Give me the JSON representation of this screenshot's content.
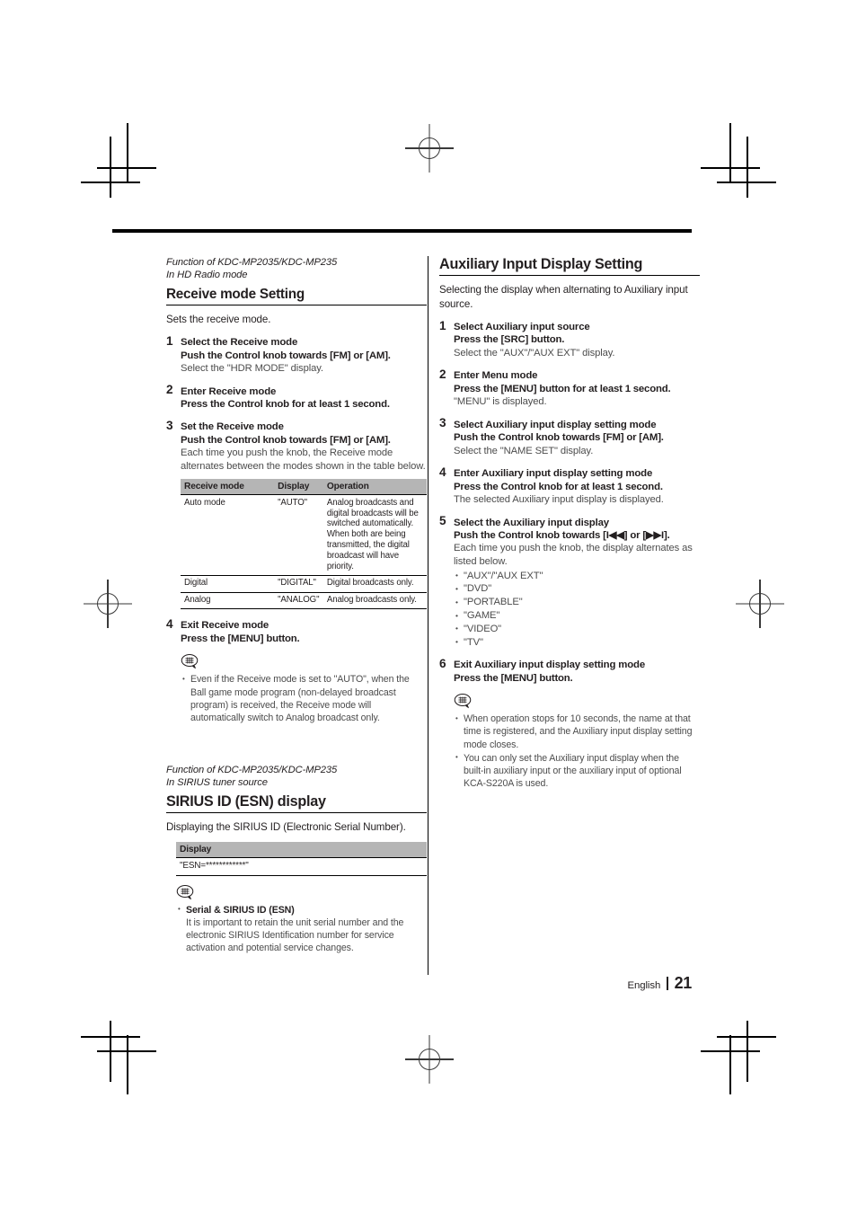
{
  "page": {
    "language": "English",
    "number": "21"
  },
  "left_column": {
    "section1": {
      "function_line_1": "Function of KDC-MP2035/KDC-MP235",
      "function_line_2": "In HD Radio mode",
      "title": "Receive mode Setting",
      "intro": "Sets the receive mode.",
      "steps": [
        {
          "num": "1",
          "line1": "Select the Receive mode",
          "line2": "Push the Control knob towards [FM] or [AM].",
          "line3": "Select the \"HDR MODE\" display."
        },
        {
          "num": "2",
          "line1": "Enter Receive mode",
          "line2": "Press the Control knob for at least 1 second."
        },
        {
          "num": "3",
          "line1": "Set the Receive mode",
          "line2": "Push the Control knob towards [FM] or [AM].",
          "line3": "Each time you push the knob, the Receive mode alternates between the modes shown in the table below."
        },
        {
          "num": "4",
          "line1": "Exit Receive mode",
          "line2": "Press the [MENU] button."
        }
      ],
      "table": {
        "headers": [
          "Receive mode",
          "Display",
          "Operation"
        ],
        "rows": [
          {
            "mode": "Auto mode",
            "display": "\"AUTO\"",
            "operation": "Analog broadcasts and digital broadcasts will be switched automatically.\nWhen both are being transmitted, the digital broadcast will have priority."
          },
          {
            "mode": "Digital",
            "display": "\"DIGITAL\"",
            "operation": "Digital broadcasts only."
          },
          {
            "mode": "Analog",
            "display": "\"ANALOG\"",
            "operation": "Analog broadcasts only."
          }
        ]
      },
      "note": {
        "icon": "note-speech-bubble-icon",
        "items": [
          "Even if the Receive mode is set to \"AUTO\", when the Ball game mode program (non-delayed broadcast program) is received, the Receive mode will automatically switch to Analog broadcast only."
        ]
      }
    },
    "section2": {
      "function_line_1": "Function of KDC-MP2035/KDC-MP235",
      "function_line_2": "In SIRIUS tuner source",
      "title": "SIRIUS ID (ESN) display",
      "intro": "Displaying the SIRIUS ID (Electronic Serial Number).",
      "table": {
        "header": "Display",
        "value": "\"ESN=************\""
      },
      "note": {
        "icon": "note-speech-bubble-icon",
        "items": [
          {
            "bold": "Serial & SIRIUS ID (ESN)",
            "text": "It is important to retain the unit serial number and the electronic SIRIUS Identification number for service activation and potential service changes."
          }
        ]
      }
    }
  },
  "right_column": {
    "section1": {
      "title": "Auxiliary Input Display Setting",
      "intro": "Selecting the display when alternating to Auxiliary input source.",
      "steps": [
        {
          "num": "1",
          "line1": "Select Auxiliary input source",
          "line2": "Press the [SRC] button.",
          "line3": "Select the \"AUX\"/\"AUX EXT\" display."
        },
        {
          "num": "2",
          "line1": "Enter Menu mode",
          "line2": "Press the [MENU] button for at least 1 second.",
          "line3": "\"MENU\" is displayed."
        },
        {
          "num": "3",
          "line1": "Select Auxiliary input display setting mode",
          "line2": "Push the Control knob towards [FM] or [AM].",
          "line3": "Select the \"NAME SET\" display."
        },
        {
          "num": "4",
          "line1": "Enter Auxiliary input display setting mode",
          "line2": "Press the Control knob for at least 1 second.",
          "line3": "The selected Auxiliary input display is displayed."
        },
        {
          "num": "5",
          "line1": "Select the Auxiliary input display",
          "line2": "Push the Control knob towards [I◀◀] or [▶▶I].",
          "line3": "Each time you push the knob, the display alternates as listed below.",
          "bullets": [
            "\"AUX\"/\"AUX EXT\"",
            "\"DVD\"",
            "\"PORTABLE\"",
            "\"GAME\"",
            "\"VIDEO\"",
            "\"TV\""
          ]
        },
        {
          "num": "6",
          "line1": "Exit Auxiliary input display setting mode",
          "line2": "Press the [MENU] button."
        }
      ],
      "note": {
        "icon": "note-speech-bubble-icon",
        "items": [
          "When operation stops for 10 seconds, the name at that time is registered, and the Auxiliary input display setting mode closes.",
          "You can only set the Auxiliary input display when the built-in auxiliary input or the auxiliary input of optional KCA-S220A is used."
        ]
      }
    }
  },
  "colors": {
    "text": "#231f20",
    "muted_text": "#4c4c4c",
    "table_header_bg": "#b5b5b5",
    "rule": "#000000"
  }
}
